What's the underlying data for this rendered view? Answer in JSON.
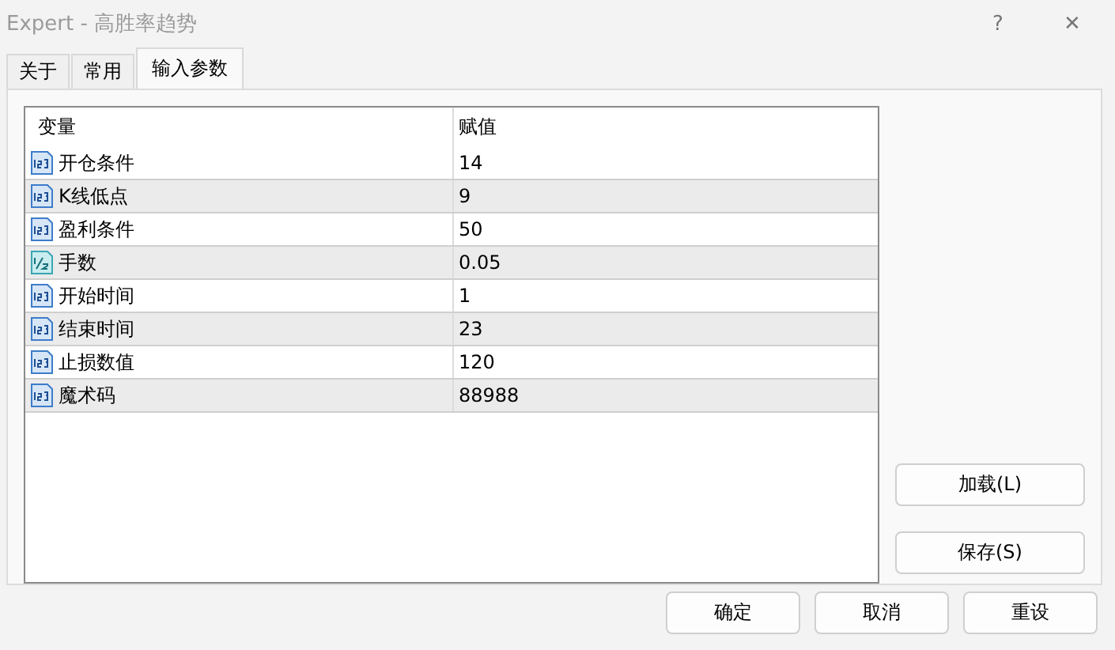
{
  "window": {
    "title": "Expert - 高胜率趋势",
    "help": "?",
    "close": "✕"
  },
  "tabs": [
    {
      "label": "关于",
      "selected": false
    },
    {
      "label": "常用",
      "selected": false
    },
    {
      "label": "输入参数",
      "selected": true
    }
  ],
  "table": {
    "columns": [
      "变量",
      "赋值"
    ],
    "rows": [
      {
        "kind": "int",
        "name": "开仓条件",
        "value": "14"
      },
      {
        "kind": "int",
        "name": "K线低点",
        "value": "9"
      },
      {
        "kind": "int",
        "name": "盈利条件",
        "value": "50"
      },
      {
        "kind": "double",
        "name": "手数",
        "value": "0.05"
      },
      {
        "kind": "int",
        "name": "开始时间",
        "value": "1"
      },
      {
        "kind": "int",
        "name": "结束时间",
        "value": "23"
      },
      {
        "kind": "int",
        "name": "止损数值",
        "value": "120"
      },
      {
        "kind": "int",
        "name": "魔术码",
        "value": "88988"
      }
    ]
  },
  "side_buttons": [
    "加载(L)",
    "保存(S)"
  ],
  "buttons": [
    "确定",
    "取消",
    "重设"
  ]
}
